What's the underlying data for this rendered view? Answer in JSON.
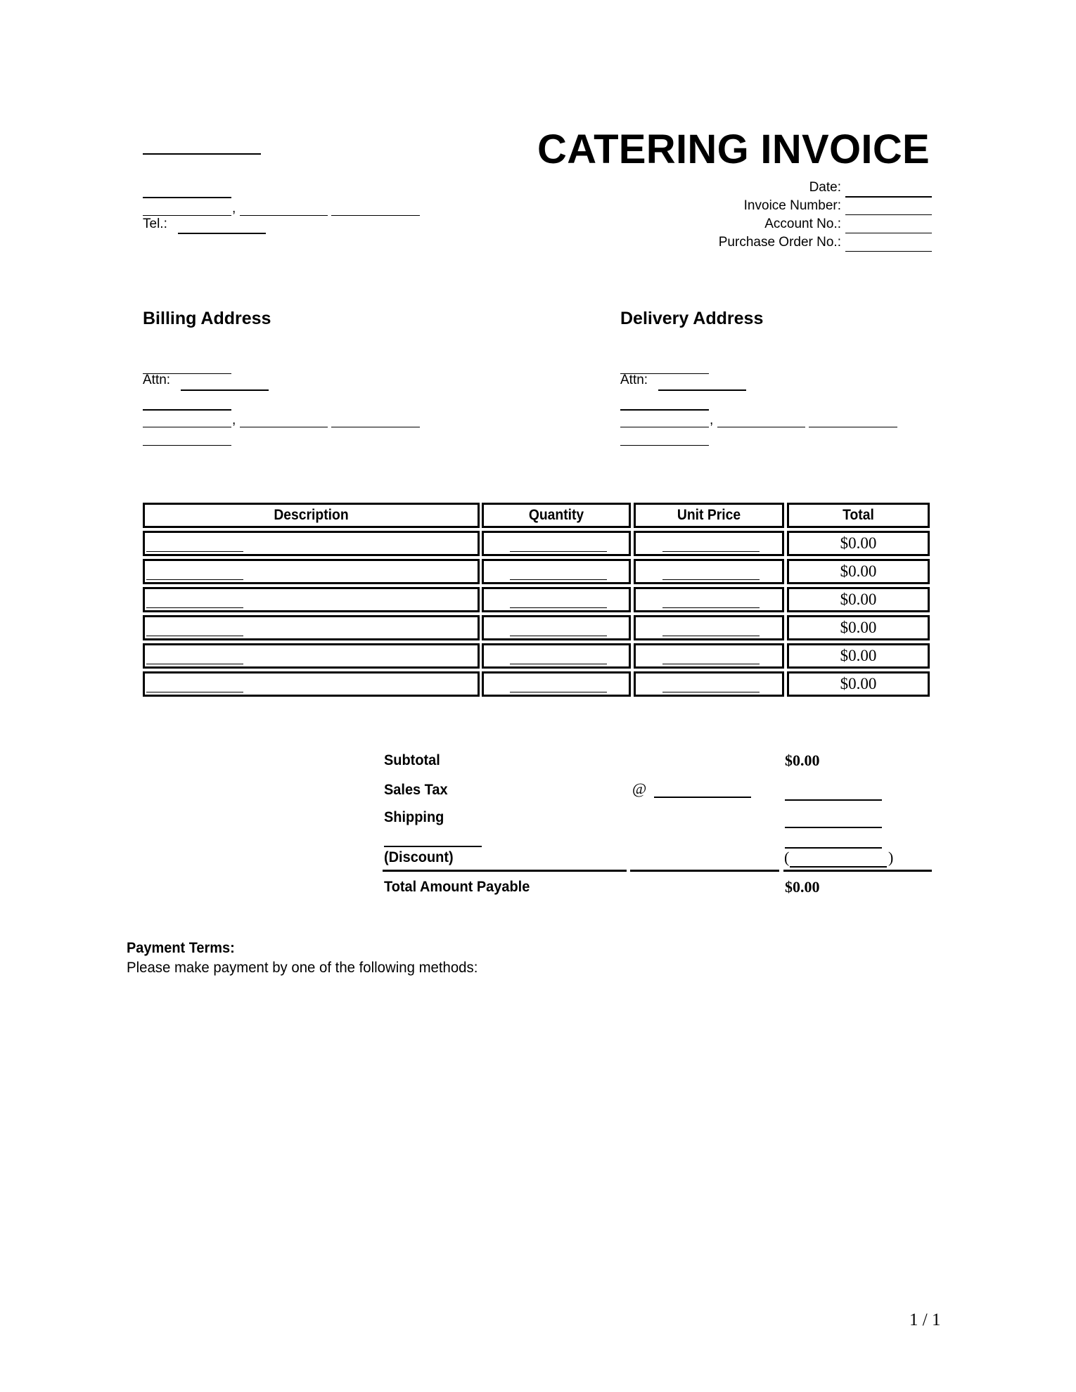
{
  "document": {
    "title": "CATERING INVOICE",
    "page_indicator": "1 / 1"
  },
  "company": {
    "name_value": "",
    "street_value": "",
    "city_value": "",
    "state_value": "",
    "zip_value": "",
    "tel_label": "Tel.:",
    "tel_value": ""
  },
  "invoice_meta": [
    {
      "label": "Date:",
      "value": ""
    },
    {
      "label": "Invoice Number:",
      "value": ""
    },
    {
      "label": "Account No.:",
      "value": ""
    },
    {
      "label": "Purchase Order No.:",
      "value": ""
    }
  ],
  "billing": {
    "heading": "Billing Address",
    "attn_label": "Attn:",
    "comma": ","
  },
  "delivery": {
    "heading": "Delivery Address",
    "attn_label": "Attn:",
    "comma": ","
  },
  "items_table": {
    "columns": [
      "Description",
      "Quantity",
      "Unit Price",
      "Total"
    ],
    "rows": [
      {
        "description": "",
        "quantity": "",
        "unit_price": "",
        "total": "$0.00"
      },
      {
        "description": "",
        "quantity": "",
        "unit_price": "",
        "total": "$0.00"
      },
      {
        "description": "",
        "quantity": "",
        "unit_price": "",
        "total": "$0.00"
      },
      {
        "description": "",
        "quantity": "",
        "unit_price": "",
        "total": "$0.00"
      },
      {
        "description": "",
        "quantity": "",
        "unit_price": "",
        "total": "$0.00"
      },
      {
        "description": "",
        "quantity": "",
        "unit_price": "",
        "total": "$0.00"
      }
    ]
  },
  "totals": {
    "subtotal_label": "Subtotal",
    "subtotal_value": "$0.00",
    "sales_tax_label": "Sales Tax",
    "sales_tax_at": "@",
    "sales_tax_rate": "",
    "sales_tax_value": "",
    "shipping_label": "Shipping",
    "shipping_value": "",
    "other_label_value": "",
    "other_value": "",
    "discount_label": "(Discount)",
    "discount_open": "(",
    "discount_close": ")",
    "discount_value": "",
    "total_label": "Total Amount Payable",
    "total_value": "$0.00"
  },
  "payment_terms": {
    "heading": "Payment Terms:",
    "text": "Please make payment by one of the following methods:"
  }
}
